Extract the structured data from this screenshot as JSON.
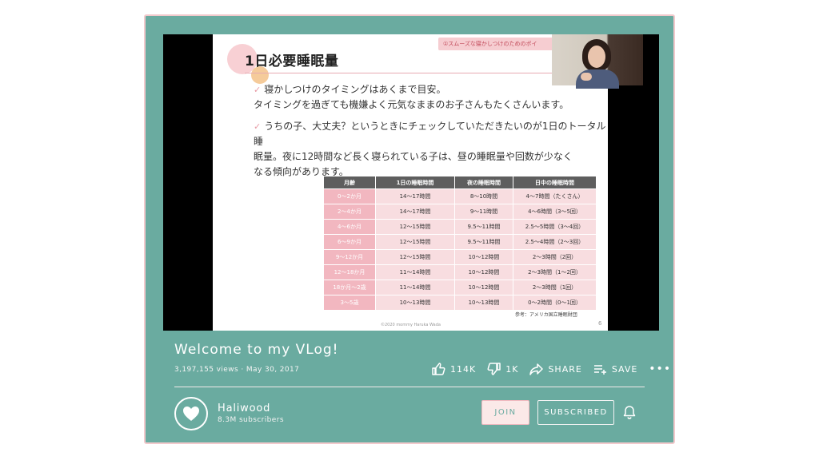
{
  "slide": {
    "tag": "①スムーズな寝かしつけのためのポイ",
    "title": "1日必要睡眠量",
    "bullets": [
      {
        "lines": [
          "寝かしつけのタイミングはあくまで目安。",
          "タイミングを過ぎても機嫌よく元気なままのお子さんもたくさんいます。"
        ]
      },
      {
        "lines": [
          "うちの子、大丈夫？というときにチェックしていただきたいのが1日のトータル睡",
          "眠量。夜に12時間など長く寝られている子は、昼の睡眠量や回数が少なく",
          "なる傾向があります。"
        ]
      }
    ],
    "table": {
      "headers": [
        "月齢",
        "1日の睡眠時間",
        "夜の睡眠時間",
        "日中の睡眠時間"
      ],
      "rows": [
        [
          "0〜2か月",
          "14〜17時間",
          "8〜10時間",
          "4〜7時間（たくさん）"
        ],
        [
          "2〜4か月",
          "14〜17時間",
          "9〜11時間",
          "4〜6時間（3〜5回）"
        ],
        [
          "4〜6か月",
          "12〜15時間",
          "9.5〜11時間",
          "2.5〜5時間（3〜4回）"
        ],
        [
          "6〜9か月",
          "12〜15時間",
          "9.5〜11時間",
          "2.5〜4時間（2〜3回）"
        ],
        [
          "9〜12か月",
          "12〜15時間",
          "10〜12時間",
          "2〜3時間（2回）"
        ],
        [
          "12〜18か月",
          "11〜14時間",
          "10〜12時間",
          "2〜3時間（1〜2回）"
        ],
        [
          "18か月〜2歳",
          "11〜14時間",
          "10〜12時間",
          "2〜3時間（1回）"
        ],
        [
          "3〜5歳",
          "10〜13時間",
          "10〜13時間",
          "0〜2時間（0〜1回）"
        ]
      ]
    },
    "reference": "参考：アメリカ国立睡眠財団",
    "copyright": "©2020 mommy Haruka Wada",
    "page_number": "6"
  },
  "video": {
    "title": "Welcome to my VLog!",
    "views": "3,197,155 views",
    "separator": " · ",
    "date": "May 30, 2017",
    "likes": "114K",
    "dislikes": "1K",
    "share_label": "SHARE",
    "save_label": "SAVE",
    "more_label": "•••"
  },
  "channel": {
    "name": "Haliwood",
    "subscribers": "8.3M subscribers",
    "join_label": "JOIN",
    "subscribed_label": "SUBSCRIBED"
  },
  "colors": {
    "card_bg": "#6aaba0",
    "card_border": "#f2c9cc",
    "accent_pink": "#f2b7c0",
    "table_header": "#5e5e5e",
    "table_cell": "#f8dde0"
  },
  "icons": [
    "thumbs-up-icon",
    "thumbs-down-icon",
    "share-icon",
    "playlist-add-icon",
    "more-icon",
    "heart-icon",
    "bell-icon",
    "checkmark-icon"
  ]
}
